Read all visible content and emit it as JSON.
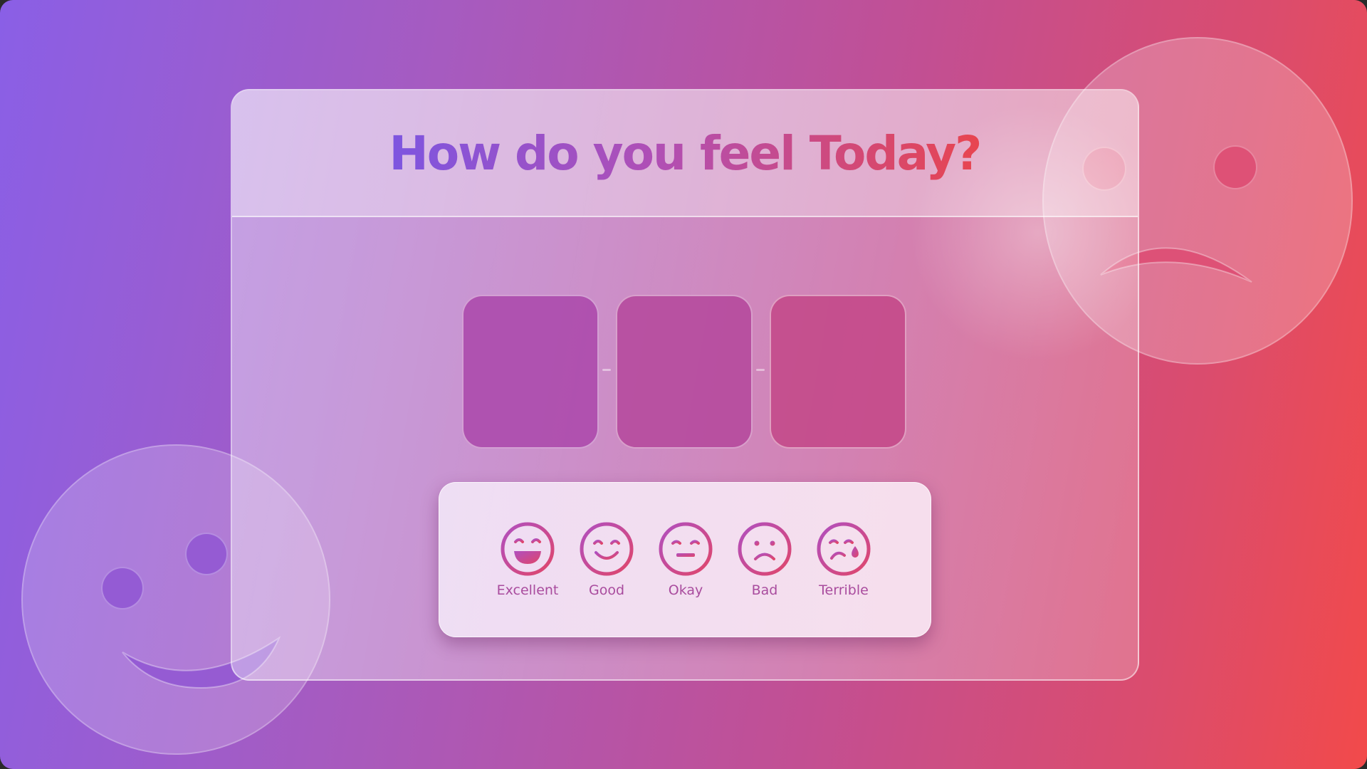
{
  "title": "How do you feel Today?",
  "colors": {
    "gradient_start": "#8a5fe6",
    "gradient_end": "#f24a4a",
    "title_start": "#7d55e0",
    "title_end": "#e8454f",
    "label": "#a94c9e"
  },
  "slots_count": 3,
  "options": [
    {
      "label": "Excellent",
      "icon": "grin-face-icon"
    },
    {
      "label": "Good",
      "icon": "smiling-face-icon"
    },
    {
      "label": "Okay",
      "icon": "neutral-face-icon"
    },
    {
      "label": "Bad",
      "icon": "frowning-face-icon"
    },
    {
      "label": "Terrible",
      "icon": "crying-face-icon"
    }
  ]
}
